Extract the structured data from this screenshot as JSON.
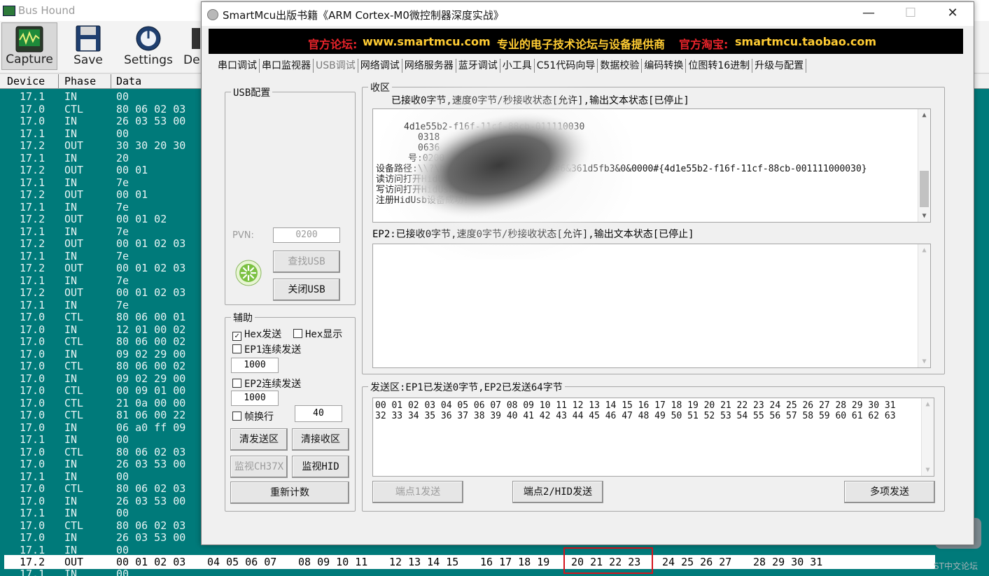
{
  "bushound": {
    "title": "Bus Hound",
    "toolbar": [
      {
        "label": "Capture",
        "icon": "oscilloscope-icon"
      },
      {
        "label": "Save",
        "icon": "floppy-disk-icon"
      },
      {
        "label": "Settings",
        "icon": "settings-dial-icon"
      },
      {
        "label": "De",
        "icon": "device-icon"
      }
    ],
    "columns": [
      "Device",
      "Phase",
      "Data"
    ],
    "rows": [
      {
        "device": "17.1",
        "phase": "IN",
        "data": "00"
      },
      {
        "device": "17.0",
        "phase": "CTL",
        "data": "80 06 02 03"
      },
      {
        "device": "17.0",
        "phase": "IN",
        "data": "26 03 53 00"
      },
      {
        "device": "17.1",
        "phase": "IN",
        "data": "00"
      },
      {
        "device": "17.2",
        "phase": "OUT",
        "data": "30 30 20 30"
      },
      {
        "device": "17.1",
        "phase": "IN",
        "data": "20"
      },
      {
        "device": "17.2",
        "phase": "OUT",
        "data": "00 01"
      },
      {
        "device": "17.1",
        "phase": "IN",
        "data": "7e"
      },
      {
        "device": "17.2",
        "phase": "OUT",
        "data": "00 01"
      },
      {
        "device": "17.1",
        "phase": "IN",
        "data": "7e"
      },
      {
        "device": "17.2",
        "phase": "OUT",
        "data": "00 01 02"
      },
      {
        "device": "17.1",
        "phase": "IN",
        "data": "7e"
      },
      {
        "device": "17.2",
        "phase": "OUT",
        "data": "00 01 02 03"
      },
      {
        "device": "17.1",
        "phase": "IN",
        "data": "7e"
      },
      {
        "device": "17.2",
        "phase": "OUT",
        "data": "00 01 02 03"
      },
      {
        "device": "17.1",
        "phase": "IN",
        "data": "7e"
      },
      {
        "device": "17.2",
        "phase": "OUT",
        "data": "00 01 02 03"
      },
      {
        "device": "17.1",
        "phase": "IN",
        "data": "7e"
      },
      {
        "device": "17.0",
        "phase": "CTL",
        "data": "80 06 00 01"
      },
      {
        "device": "17.0",
        "phase": "IN",
        "data": "12 01 00 02"
      },
      {
        "device": "17.0",
        "phase": "CTL",
        "data": "80 06 00 02"
      },
      {
        "device": "17.0",
        "phase": "IN",
        "data": "09 02 29 00"
      },
      {
        "device": "17.0",
        "phase": "CTL",
        "data": "80 06 00 02"
      },
      {
        "device": "17.0",
        "phase": "IN",
        "data": "09 02 29 00"
      },
      {
        "device": "17.0",
        "phase": "CTL",
        "data": "00 09 01 00"
      },
      {
        "device": "17.0",
        "phase": "CTL",
        "data": "21 0a 00 00"
      },
      {
        "device": "17.0",
        "phase": "CTL",
        "data": "81 06 00 22"
      },
      {
        "device": "17.0",
        "phase": "IN",
        "data": "06 a0 ff 09"
      },
      {
        "device": "17.1",
        "phase": "IN",
        "data": "00"
      },
      {
        "device": "17.0",
        "phase": "CTL",
        "data": "80 06 02 03"
      },
      {
        "device": "17.0",
        "phase": "IN",
        "data": "26 03 53 00"
      },
      {
        "device": "17.1",
        "phase": "IN",
        "data": "00"
      },
      {
        "device": "17.0",
        "phase": "CTL",
        "data": "80 06 02 03"
      },
      {
        "device": "17.0",
        "phase": "IN",
        "data": "26 03 53 00"
      },
      {
        "device": "17.1",
        "phase": "IN",
        "data": "00"
      },
      {
        "device": "17.0",
        "phase": "CTL",
        "data": "80 06 02 03"
      },
      {
        "device": "17.0",
        "phase": "IN",
        "data": "26 03 53 00"
      },
      {
        "device": "17.1",
        "phase": "IN",
        "data": "00"
      }
    ],
    "highlighted_row": {
      "device": "17.2",
      "phase": "OUT",
      "groups": [
        "00 01 02 03",
        "04 05 06 07",
        "08 09 10 11",
        "12 13 14 15",
        "16 17 18 19",
        "20 21 22 23",
        "24 25 26 27",
        "28 29 30 31"
      ]
    },
    "last_row": {
      "device": "17.1",
      "phase": "IN",
      "data": "00"
    },
    "watermark": "ST中文论坛",
    "highlight_color": "#d4141e",
    "list_bg": "#007a7a"
  },
  "smartmcu": {
    "title": "SmartMcu出版书籍《ARM Cortex-M0微控制器深度实战》",
    "controls": {
      "minimize": "—",
      "maximize": "☐",
      "close": "✕"
    },
    "banner": {
      "forum_label": "官方论坛:",
      "forum_url": "www.smartmcu.com",
      "slogan": "专业的电子技术论坛与设备提供商",
      "shop_label": "官方淘宝:",
      "shop_url": "smartmcu.taobao.com"
    },
    "tabs": [
      "串口调试",
      "串口监视器",
      "USB调试",
      "网络调试",
      "网络服务器",
      "蓝牙调试",
      "小工具",
      "C51代码向导",
      "数据校验",
      "编码转换",
      "位图转16进制",
      "升级与配置"
    ],
    "selected_tab": "USB调试",
    "usb_config": {
      "title": "USB配置",
      "pvn_label": "PVN:",
      "pvn_value": "0200",
      "find_button": "查找USB",
      "close_button": "关闭USB"
    },
    "aux": {
      "title": "辅助",
      "hex_send": "Hex发送",
      "hex_send_checked": true,
      "hex_display": "Hex显示",
      "ep1_cont": "EP1连续发送",
      "ep1_interval": "1000",
      "ep2_cont": "EP2连续发送",
      "ep2_interval": "1000",
      "frame_newline": "帧换行",
      "frame_value": "40",
      "clear_send": "清发送区",
      "clear_recv": "清接收区",
      "monitor_ch37x": "监视CH37X",
      "monitor_hid": "监视HID",
      "recount": "重新计数"
    },
    "recv": {
      "group_title": "收区",
      "ep1_status": "已接收0字节,速度0字节/秒接收状态[允许],输出文本状态[已停止]",
      "lines": [
        "4d1e55b2-f16f-11cf-88cb-011110030",
        "0318",
        "0636",
        "号:0200",
        "设备路径:\\\\?\\hid#vid_0318&pid_0636#6&361d5fb3&0&0000#{4d1e55b2-f16f-11cf-88cb-001111000030}",
        "读访问打开HidUsb设备成功!",
        "写访问打开HidUsb设备成功!",
        "注册HidUsb设备成功!"
      ],
      "ep2_status": "EP2:已接收0字节,速度0字节/秒接收状态[允许],输出文本状态[已停止]"
    },
    "send": {
      "title": "发送区:EP1已发送0字节,EP2已发送64字节",
      "line1": "00 01 02 03 04 05 06 07 08 09 10 11 12 13 14 15 16 17 18 19 20 21 22 23 24 25 26 27 28 29 30 31",
      "line2": "32 33 34 35 36 37 38 39 40 41 42 43 44 45 46 47 48 49 50 51 52 53 54 55 56 57 58 59 60 61 62 63",
      "ep1_button": "端点1发送",
      "ep2_button": "端点2/HID发送",
      "multi_button": "多项发送"
    },
    "colors": {
      "banner_label": "#e8232a",
      "banner_text": "#ffcc33"
    }
  }
}
